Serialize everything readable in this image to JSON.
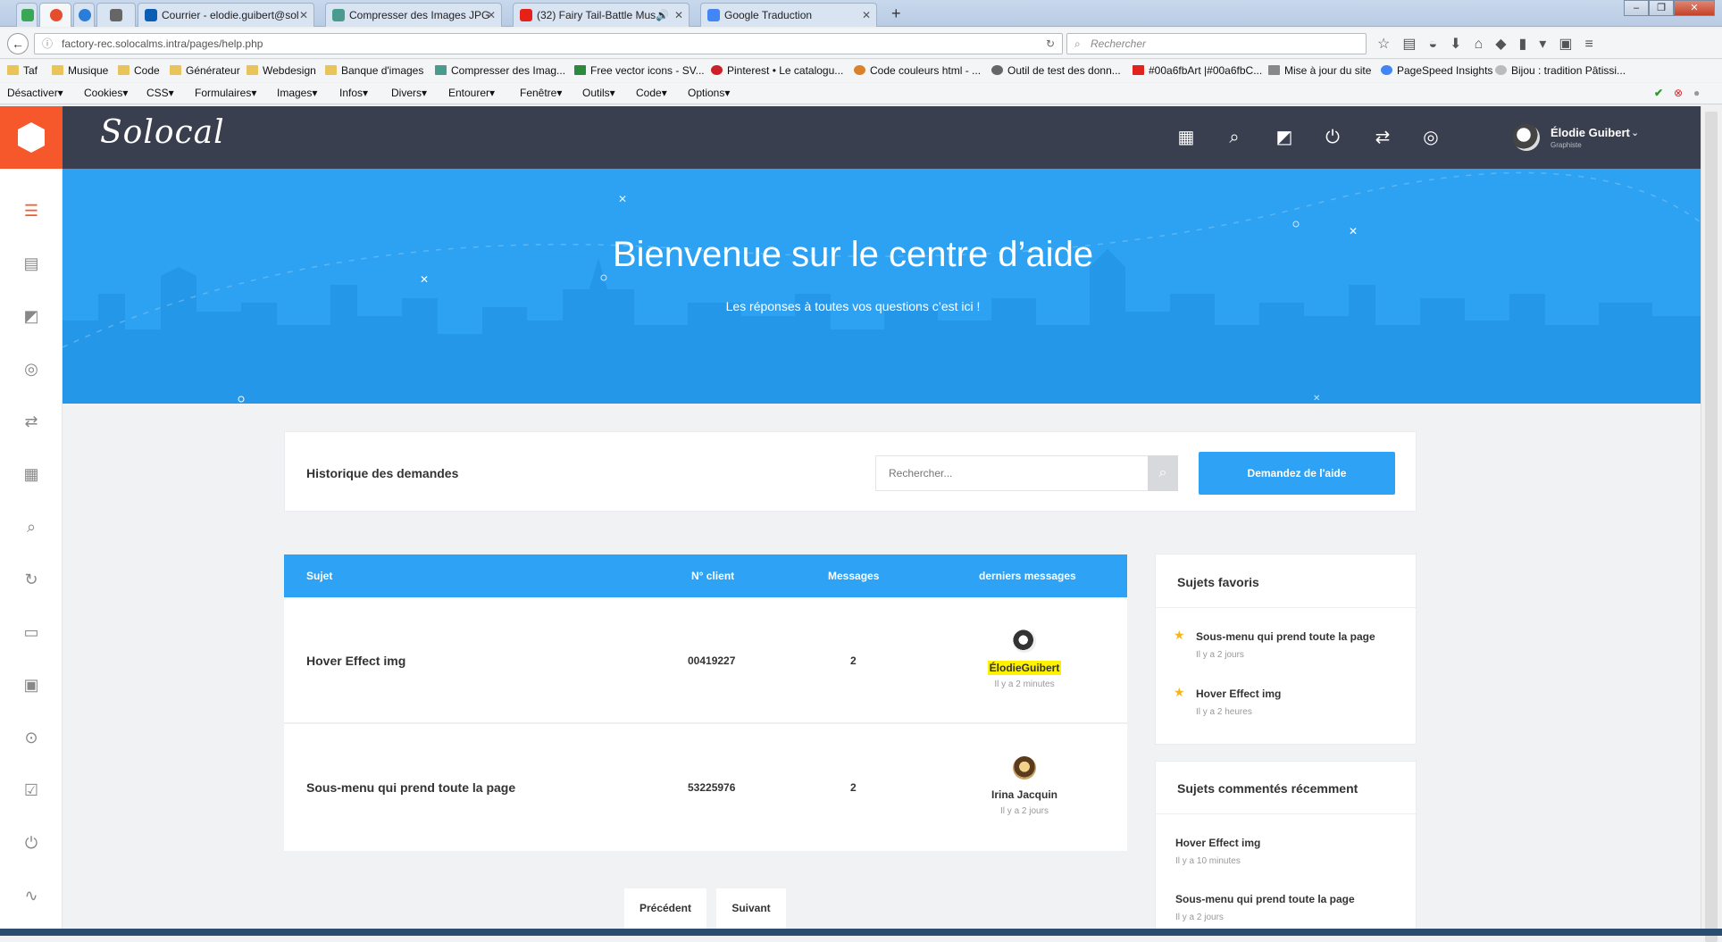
{
  "browser": {
    "tabs": [
      {
        "label": "",
        "color": "#3aa757"
      },
      {
        "label": "",
        "color": "#e44d2e"
      },
      {
        "label": "",
        "color": "#2a7ed9"
      },
      {
        "label": "",
        "color": "#666666"
      },
      {
        "label": "Courrier - elodie.guibert@sol",
        "color": "#0a5fb4"
      },
      {
        "label": "Compresser des Images JPG",
        "color": "#4a9b8e"
      },
      {
        "label": "(32) Fairy Tail-Battle Mus",
        "color": "#e62117"
      },
      {
        "label": "Google Traduction",
        "color": "#4285f4"
      }
    ],
    "window_controls": {
      "minimize": "‒",
      "restore": "❐",
      "close": "✕"
    },
    "url": "factory-rec.solocalms.intra/pages/help.php",
    "search_placeholder": "Rechercher",
    "bookmarks": [
      "Taf",
      "Musique",
      "Code",
      "Générateur",
      "Webdesign",
      "Banque d'images",
      "Compresser des Imag...",
      "Free vector icons - SV...",
      "Pinterest • Le catalogu...",
      "Code couleurs html - ...",
      "Outil de test des donn...",
      "#00a6fbArt |#00a6fbC...",
      "Mise à jour du site",
      "PageSpeed Insights",
      "Bijou : tradition Pâtissi..."
    ],
    "devtools": [
      "Désactiver▾",
      "Cookies▾",
      "CSS▾",
      "Formulaires▾",
      "Images▾",
      "Infos▾",
      "Divers▾",
      "Entourer▾",
      "Fenêtre▾",
      "Outils▾",
      "Code▾",
      "Options▾"
    ]
  },
  "header": {
    "brand": "Solocal",
    "icons": [
      "calendar-icon",
      "search-icon",
      "chart-icon",
      "plug-icon",
      "share-icon",
      "support-icon"
    ],
    "user": {
      "name": "Élodie Guibert",
      "role": "Graphiste"
    }
  },
  "sidebar": {
    "icons": [
      "menu-icon",
      "list-icon",
      "image-icon",
      "support-icon",
      "share-icon",
      "grid-icon",
      "search-icon",
      "refresh-icon",
      "article-icon",
      "calendar-icon",
      "location-icon",
      "checklist-icon",
      "plug-icon",
      "activity-icon"
    ]
  },
  "hero": {
    "title": "Bienvenue sur le centre d’aide",
    "subtitle": "Les réponses à toutes vos questions c’est ici !"
  },
  "history": {
    "title": "Historique des demandes",
    "search_placeholder": "Rechercher...",
    "help_button": "Demandez de l'aide"
  },
  "table": {
    "headers": [
      "Sujet",
      "N° client",
      "Messages",
      "derniers messages"
    ],
    "rows": [
      {
        "subject": "Hover Effect img",
        "client": "00419227",
        "messages": "2",
        "user": "ÉlodieGuibert",
        "time": "Il y a 2 minutes"
      },
      {
        "subject": "Sous-menu qui prend toute la page",
        "client": "53225976",
        "messages": "2",
        "user": "Irina Jacquin",
        "time": "Il y a 2 jours"
      }
    ]
  },
  "pagination": {
    "prev": "Précédent",
    "next": "Suivant"
  },
  "favorites": {
    "title": "Sujets favoris",
    "items": [
      {
        "title": "Sous-menu qui prend toute la page",
        "time": "Il y a 2 jours"
      },
      {
        "title": "Hover Effect img",
        "time": "Il y a 2 heures"
      }
    ]
  },
  "recent": {
    "title": "Sujets commentés récemment",
    "items": [
      {
        "title": "Hover Effect img",
        "time": "Il y a 10 minutes"
      },
      {
        "title": "Sous-menu qui prend toute la page",
        "time": "Il y a 2 jours"
      }
    ]
  },
  "colors": {
    "accent": "#2ea2f4",
    "orange": "#f7582b",
    "header": "#3a3f4f",
    "highlight": "#fff200"
  }
}
